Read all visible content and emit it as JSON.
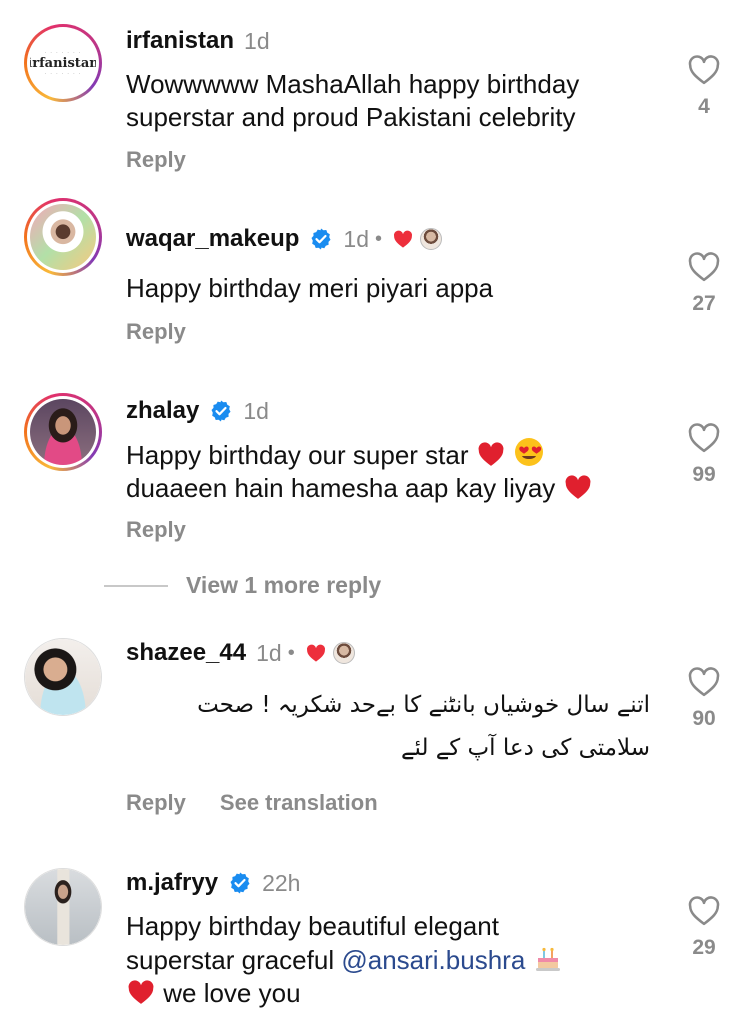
{
  "comments": [
    {
      "username": "irfanistan",
      "time": "1d",
      "avatar_text": "irfanistan",
      "text_lines": [
        "Wowwwww MashaAllah happy birthday",
        "superstar and proud Pakistani celebrity"
      ],
      "likes": "4",
      "reply_label": "Reply"
    },
    {
      "username": "waqar_makeup",
      "time": "1d",
      "dot": "•",
      "text_lines": [
        "Happy birthday meri piyari appa"
      ],
      "likes": "27",
      "reply_label": "Reply"
    },
    {
      "username": "zhalay",
      "time": "1d",
      "text_lines": [
        "Happy birthday our super star",
        "duaaeen hain hamesha aap kay liyay"
      ],
      "likes": "99",
      "reply_label": "Reply"
    },
    {
      "username": "shazee_44",
      "time": "1d",
      "dot": "•",
      "text_lines": [
        "اتنے سال خوشیاں بانٹنے کا بےحد شکریہ ! صحت",
        "سلامتی کی دعا آپ کے لئے"
      ],
      "likes": "90",
      "reply_label": "Reply",
      "translate_label": "See translation"
    },
    {
      "username": "m.jafryy",
      "time": "22h",
      "text_lines": [
        "Happy birthday beautiful elegant",
        "superstar graceful",
        "@ansari.bushra",
        "we love you"
      ],
      "likes": "29"
    }
  ],
  "view_more": "View 1 more reply",
  "colors": {
    "verified": "#1a8cf0",
    "heart_red": "#ed2f3c",
    "muted": "#8a8a8a",
    "mention": "#2b4a8e"
  },
  "icons": {
    "like": "heart-outline-icon",
    "verified": "verified-badge-icon",
    "liked_by_author": "heart-filled-icon"
  }
}
